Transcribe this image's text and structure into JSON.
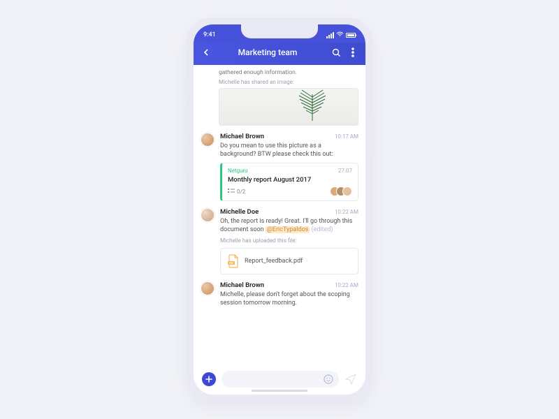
{
  "statusbar": {
    "time": "9:41"
  },
  "navbar": {
    "title": "Marketing team"
  },
  "chat": {
    "cut_prefix": "gathered enough information.",
    "sys_image_shared": "Michelle has shared an image:",
    "msg1": {
      "name": "Michael Brown",
      "time": "10:17 AM",
      "text": "Do you mean to use this picture as a background? BTW please check this out:"
    },
    "task": {
      "source": "Netguru",
      "date": "27.07",
      "title": "Monthly report August 2017",
      "count": "0/2"
    },
    "msg2": {
      "name": "Michelle Doe",
      "time": "10:22 AM",
      "text_pre": "Oh, the report is ready! Great. I'll go through this document soon ",
      "mention": "@EricTypaldos",
      "edited": " (edited)"
    },
    "sys_file_uploaded": "Michelle has uploaded this file:",
    "file": {
      "name": "Report_feedback.pdf"
    },
    "msg3": {
      "name": "Michael Brown",
      "time": "10:22 AM",
      "text": "Michelle, please don't forget about the scoping session tomorrow morning."
    }
  },
  "composer": {
    "placeholder": ""
  }
}
